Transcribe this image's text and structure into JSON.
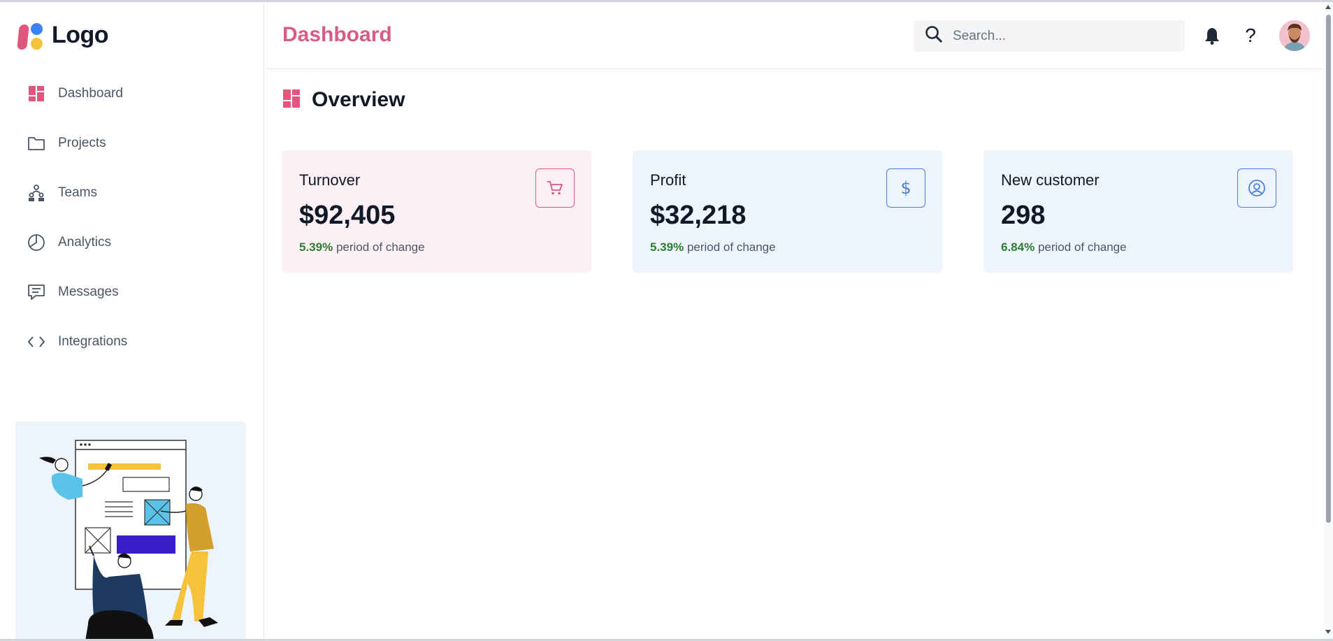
{
  "brand": {
    "name": "Logo"
  },
  "sidebar": {
    "items": [
      {
        "label": "Dashboard",
        "icon": "dashboard-icon"
      },
      {
        "label": "Projects",
        "icon": "folder-icon"
      },
      {
        "label": "Teams",
        "icon": "teams-icon"
      },
      {
        "label": "Analytics",
        "icon": "pie-chart-icon"
      },
      {
        "label": "Messages",
        "icon": "message-icon"
      },
      {
        "label": "Integrations",
        "icon": "code-icon"
      }
    ]
  },
  "header": {
    "title": "Dashboard",
    "search_placeholder": "Search..."
  },
  "main": {
    "section_title": "Overview",
    "cards": [
      {
        "title": "Turnover",
        "value": "$92,405",
        "change": "5.39%",
        "change_label": "period of change",
        "icon": "cart-icon"
      },
      {
        "title": "Profit",
        "value": "$32,218",
        "change": "5.39%",
        "change_label": "period of change",
        "icon": "dollar-icon"
      },
      {
        "title": "New customer",
        "value": "298",
        "change": "6.84%",
        "change_label": "period of change",
        "icon": "user-circle-icon"
      }
    ]
  },
  "colors": {
    "accent": "#d85b87",
    "blue": "#4a7fd8",
    "positive": "#2f7d32"
  }
}
